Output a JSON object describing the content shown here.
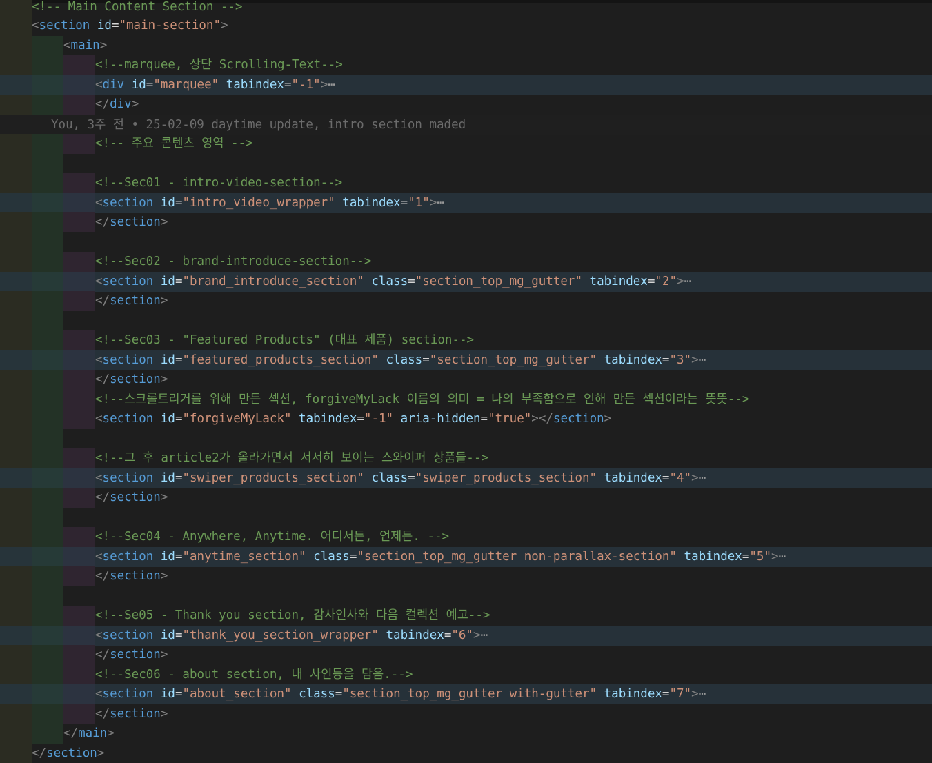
{
  "blame": "You, 3주 전 • 25-02-09 daytime update, intro section maded",
  "lines": {
    "l0": {
      "cm": "<!-- Main Content Section -->"
    },
    "l1": {
      "tag": "section",
      "a1": "id",
      "v1": "\"main-section\""
    },
    "l2": {
      "tag": "main"
    },
    "l3": {
      "cm": "<!--marquee, 상단 Scrolling-Text-->"
    },
    "l4": {
      "tag": "div",
      "a1": "id",
      "v1": "\"marquee\"",
      "a2": "tabindex",
      "v2": "\"-1\"",
      "fold": "⋯"
    },
    "l5": {
      "tag": "div"
    },
    "l6": {
      "cm": "<!-- 주요 콘텐츠 영역 -->"
    },
    "l8": {
      "cm": "<!--Sec01 - intro-video-section-->"
    },
    "l9": {
      "tag": "section",
      "a1": "id",
      "v1": "\"intro_video_wrapper\"",
      "a2": "tabindex",
      "v2": "\"1\"",
      "fold": "⋯"
    },
    "l10": {
      "tag": "section"
    },
    "l12": {
      "cm": "<!--Sec02 - brand-introduce-section-->"
    },
    "l13": {
      "tag": "section",
      "a1": "id",
      "v1": "\"brand_introduce_section\"",
      "a2": "class",
      "v2": "\"section_top_mg_gutter\"",
      "a3": "tabindex",
      "v3": "\"2\"",
      "fold": "⋯"
    },
    "l14": {
      "tag": "section"
    },
    "l16": {
      "cm": "<!--Sec03 - \"Featured Products\" (대표 제품) section-->"
    },
    "l17": {
      "tag": "section",
      "a1": "id",
      "v1": "\"featured_products_section\"",
      "a2": "class",
      "v2": "\"section_top_mg_gutter\"",
      "a3": "tabindex",
      "v3": "\"3\"",
      "fold": "⋯"
    },
    "l18": {
      "tag": "section"
    },
    "l19": {
      "cm": "<!--스크롤트리거를 위해 만든 섹션, forgiveMyLack 이름의 의미 = 나의 부족함으로 인해 만든 섹션이라는 뜻뜻-->"
    },
    "l20": {
      "tag": "section",
      "a1": "id",
      "v1": "\"forgiveMyLack\"",
      "a2": "tabindex",
      "v2": "\"-1\"",
      "a3": "aria-hidden",
      "v3": "\"true\""
    },
    "l22": {
      "cm": "<!--그 후 article2가 올라가면서 서서히 보이는 스와이퍼 상품들-->"
    },
    "l23": {
      "tag": "section",
      "a1": "id",
      "v1": "\"swiper_products_section\"",
      "a2": "class",
      "v2": "\"swiper_products_section\"",
      "a3": "tabindex",
      "v3": "\"4\"",
      "fold": "⋯"
    },
    "l24": {
      "tag": "section"
    },
    "l26": {
      "cm": "<!--Sec04 - Anywhere, Anytime. 어디서든, 언제든. -->"
    },
    "l27": {
      "tag": "section",
      "a1": "id",
      "v1": "\"anytime_section\"",
      "a2": "class",
      "v2": "\"section_top_mg_gutter non-parallax-section\"",
      "a3": "tabindex",
      "v3": "\"5\"",
      "fold": "⋯"
    },
    "l28": {
      "tag": "section"
    },
    "l30": {
      "cm": "<!--Se05 - Thank you section, 감사인사와 다음 컬렉션 예고-->"
    },
    "l31": {
      "tag": "section",
      "a1": "id",
      "v1": "\"thank_you_section_wrapper\"",
      "a2": "tabindex",
      "v2": "\"6\"",
      "fold": "⋯"
    },
    "l32": {
      "tag": "section"
    },
    "l33": {
      "cm": "<!--Sec06 - about section, 내 사인등을 담음.-->"
    },
    "l34": {
      "tag": "section",
      "a1": "id",
      "v1": "\"about_section\"",
      "a2": "class",
      "v2": "\"section_top_mg_gutter with-gutter\"",
      "a3": "tabindex",
      "v3": "\"7\"",
      "fold": "⋯"
    },
    "l35": {
      "tag": "section"
    },
    "l36": {
      "tag": "main"
    },
    "l37": {
      "tag": "section"
    }
  },
  "colors": {
    "background": "#1e1e1e",
    "comment": "#6a9955",
    "tag": "#569cd6",
    "attribute": "#9cdcfe",
    "string": "#ce9178",
    "punctuation": "#808080"
  }
}
